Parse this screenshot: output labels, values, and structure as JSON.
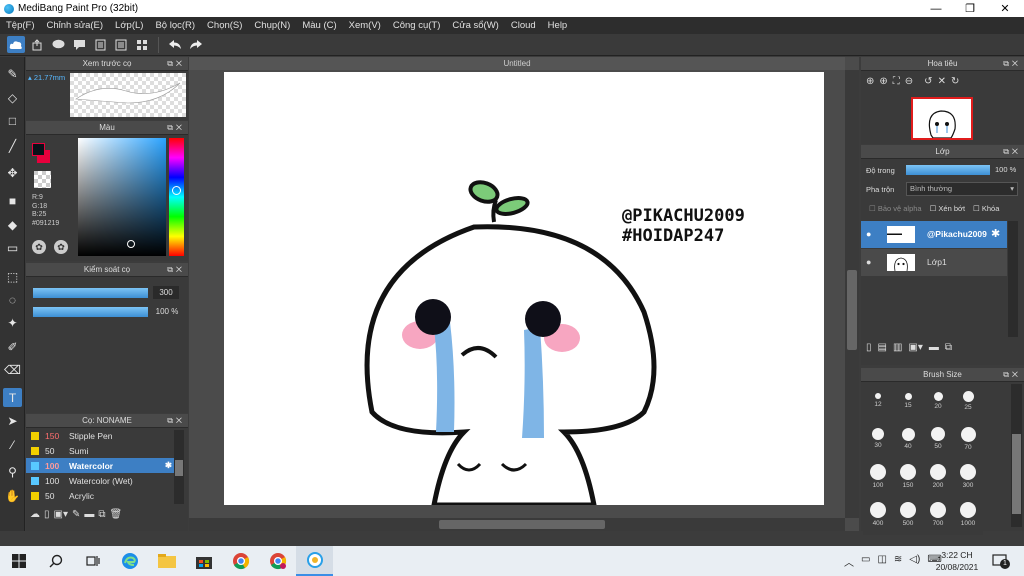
{
  "window": {
    "title": "MediBang Paint Pro (32bit)",
    "controls": [
      "—",
      "❐",
      "✕"
    ]
  },
  "menu": [
    "Tệp(F)",
    "Chỉnh sửa(E)",
    "Lớp(L)",
    "Bộ lọc(R)",
    "Chọn(S)",
    "Chụp(N)",
    "Màu (C)",
    "Xem(V)",
    "Công cụ(T)",
    "Cửa sổ(W)",
    "Cloud",
    "Help"
  ],
  "toolbar_icons": [
    "cloud-icon",
    "share-icon",
    "chat-icon",
    "comment-icon",
    "page-icon",
    "list-icon",
    "grid-icon",
    "undo-icon",
    "redo-icon"
  ],
  "left_tools": [
    "brush-icon",
    "eraser-icon",
    "rectangle-icon",
    "line-icon",
    "move-icon",
    "fill-rect-icon",
    "bucket-icon",
    "gradient-icon",
    "select-rect-icon",
    "lasso-icon",
    "magic-wand-icon",
    "select-pen-icon",
    "select-eraser-icon",
    "text-icon",
    "operation-icon",
    "eyedropper-icon",
    "divide-icon",
    "hand-icon"
  ],
  "brush_preview": {
    "title": "Xem trước cọ",
    "size": "21.77mm"
  },
  "color_panel": {
    "title": "Màu",
    "fg_color": "#091219",
    "bg_color": "#e8003c",
    "r": "R:9",
    "g": "G:18",
    "b": "B:25",
    "hex": "#091219"
  },
  "brush_control": {
    "title": "Kiểm soát cọ",
    "size_value": "300",
    "opacity_value": "100 %"
  },
  "brush_list": {
    "title": "Cọ: NONAME",
    "items": [
      {
        "size": "150",
        "name": "Stipple Pen",
        "color": "#f2d000",
        "size_color": "#ff6e6e"
      },
      {
        "size": "50",
        "name": "Sumi",
        "color": "#f2d000",
        "size_color": "#e0e0e0"
      },
      {
        "size": "100",
        "name": "Watercolor",
        "color": "#58c8ff",
        "size_color": "#ff6e6e"
      },
      {
        "size": "100",
        "name": "Watercolor (Wet)",
        "color": "#58c8ff",
        "size_color": "#e0e0e0"
      },
      {
        "size": "50",
        "name": "Acrylic",
        "color": "#f2d000",
        "size_color": "#e0e0e0"
      }
    ],
    "selected_index": 2
  },
  "canvas": {
    "tab_title": "Untitled",
    "watermark_line1": "@PIKACHU2009",
    "watermark_line2": "#HOIDAP247"
  },
  "navigator": {
    "title": "Hoa tiêu"
  },
  "layer_panel": {
    "title": "Lớp",
    "opacity_label": "Độ trong",
    "opacity_value": "100 %",
    "opacity": 1.0,
    "blend_label": "Pha trộn",
    "blend_value": "Bình thường",
    "protect_alpha": "Bảo vệ alpha",
    "clipping": "Xén bớt",
    "lock": "Khóa",
    "layers": [
      {
        "name": "@Pikachu2009",
        "selected": true
      },
      {
        "name": "Lớp1",
        "selected": false
      }
    ]
  },
  "brush_size_panel": {
    "title": "Brush Size",
    "sizes": [
      "12",
      "15",
      "20",
      "25",
      "30",
      "40",
      "50",
      "70",
      "100",
      "150",
      "200",
      "300",
      "400",
      "500",
      "700",
      "1000"
    ]
  },
  "taskbar": {
    "time": "3:22 CH",
    "date": "20/08/2021",
    "notification_count": "1"
  }
}
